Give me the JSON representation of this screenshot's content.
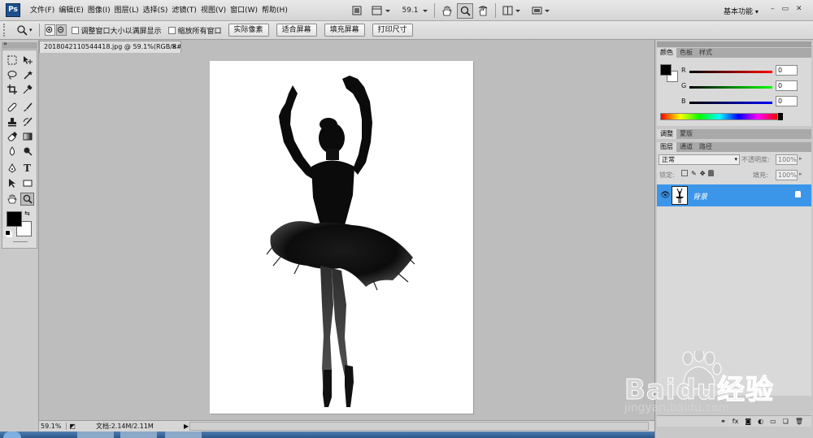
{
  "app": {
    "logo": "Ps"
  },
  "menus": [
    "文件(F)",
    "编辑(E)",
    "图像(I)",
    "图层(L)",
    "选择(S)",
    "滤镜(T)",
    "视图(V)",
    "窗口(W)",
    "帮助(H)"
  ],
  "menubar": {
    "zoom": "59.1",
    "workspace": "基本功能"
  },
  "options": {
    "check_resize_window": "调整窗口大小以满屏显示",
    "check_zoom_all": "缩放所有窗口",
    "btn_actual_pixels": "实际像素",
    "btn_fit_screen": "适合屏幕",
    "btn_fill_screen": "填充屏幕",
    "btn_print_size": "打印尺寸"
  },
  "document": {
    "tab_title": "2018042110544418.jpg @ 59.1%(RGB/8#)",
    "close": "×"
  },
  "status": {
    "zoom": "59.1%",
    "doc_info": "文档:2.14M/2.11M"
  },
  "color_panel": {
    "tabs": [
      "颜色",
      "色板",
      "样式"
    ],
    "r_label": "R",
    "g_label": "G",
    "b_label": "B",
    "r_value": "0",
    "g_value": "0",
    "b_value": "0"
  },
  "adjust_panel": {
    "tabs": [
      "调整",
      "蒙版"
    ]
  },
  "layers_panel": {
    "tabs": [
      "图层",
      "通道",
      "路径"
    ],
    "blend_mode": "正常",
    "opacity_label": "不透明度:",
    "opacity_value": "100%",
    "lock_label": "锁定:",
    "fill_label": "填充:",
    "fill_value": "100%",
    "layer_name": "背景"
  },
  "colors": {
    "foreground": "#000000",
    "background": "#ffffff",
    "selected_layer": "#3b95e9"
  },
  "watermark": {
    "text": "Baidu经验",
    "url": "jingyan.baidu.com"
  }
}
